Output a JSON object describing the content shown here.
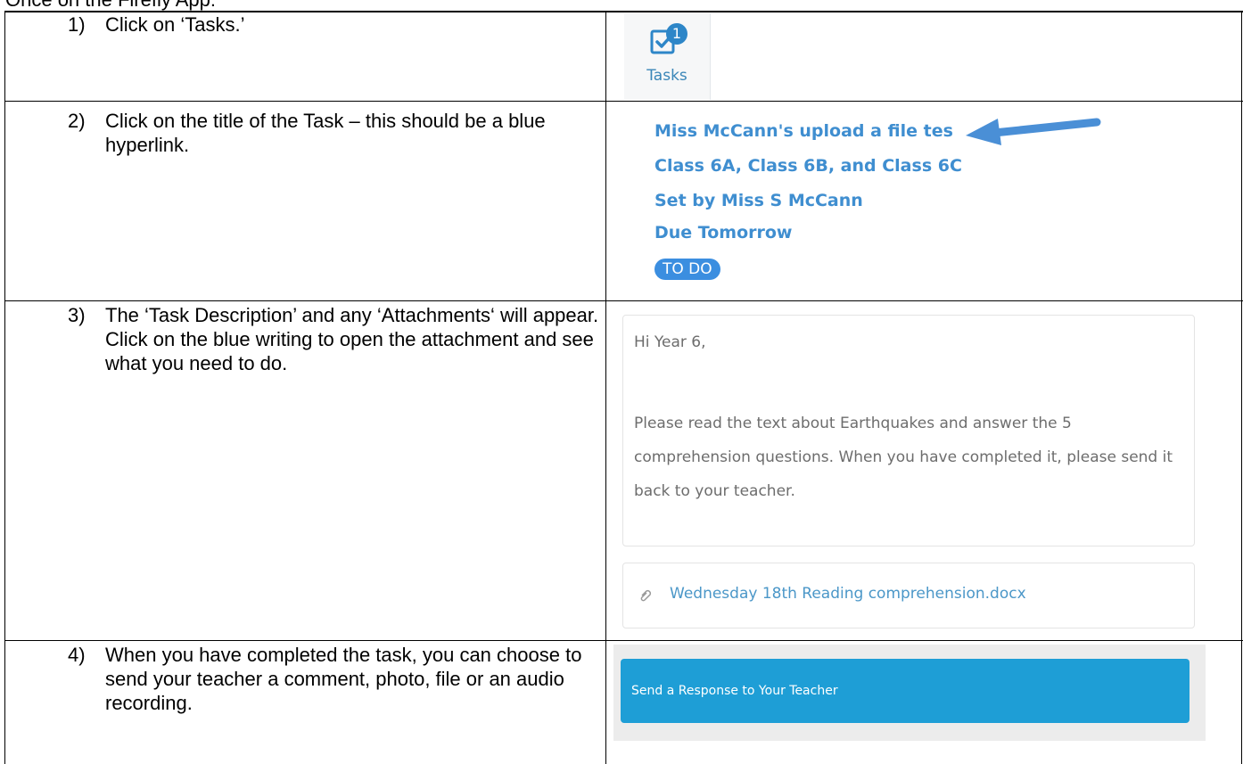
{
  "header_partial": "Once on the Firefly App:",
  "steps": [
    {
      "num": "1)",
      "text": "Click on ‘Tasks.’"
    },
    {
      "num": "2)",
      "text": "Click on the title of the Task – this should be a blue hyperlink."
    },
    {
      "num": "3)",
      "text": "The ‘Task Description’ and any ‘Attachments‘ will appear. Click on the blue writing to open the attachment and see what you need to do."
    },
    {
      "num": "4)",
      "text": "When you have completed the task, you can choose to send your teacher a comment, photo, file or an audio recording."
    }
  ],
  "tasks_panel": {
    "badge_count": "1",
    "label": "Tasks",
    "icon": "task-checkbox-icon"
  },
  "task_card": {
    "title": "Miss McCann's upload a file tes",
    "classes": "Class 6A, Class 6B, and Class 6C",
    "set_by": "Set by Miss S McCann",
    "due": "Due Tomorrow",
    "status": "TO DO",
    "arrow_icon": "blue-arrow-icon"
  },
  "description": {
    "greeting": "Hi Year 6,",
    "body": "Please read the text about Earthquakes and answer the 5 comprehension questions. When you have completed it, please send it back to your teacher."
  },
  "attachment": {
    "icon": "attachment-icon",
    "filename": "Wednesday 18th Reading comprehension.docx"
  },
  "response": {
    "button_label": "Send a Response to Your Teacher"
  },
  "colors": {
    "link_blue": "#3f8ed0",
    "pill_blue": "#3b8ee0",
    "button_blue": "#1e9ed6",
    "arrow_blue": "#4a8fd6"
  }
}
